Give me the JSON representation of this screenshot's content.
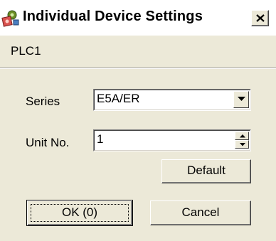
{
  "window": {
    "title": "Individual Device Settings",
    "close_symbol": "×"
  },
  "device": {
    "name": "PLC1"
  },
  "form": {
    "series_label": "Series",
    "series_value": "E5A/ER",
    "unit_label": "Unit No.",
    "unit_value": "1"
  },
  "buttons": {
    "default_label": "Default",
    "ok_label": "OK (0)",
    "cancel_label": "Cancel"
  },
  "icons": {
    "title_icon": "settings-device-icon",
    "close": "close-icon",
    "dropdown": "chevron-down-icon",
    "spin_up": "arrow-up-icon",
    "spin_down": "arrow-down-icon"
  },
  "colors": {
    "dialog_bg": "#ece9d8",
    "titlebar_bg": "#ffffff"
  }
}
